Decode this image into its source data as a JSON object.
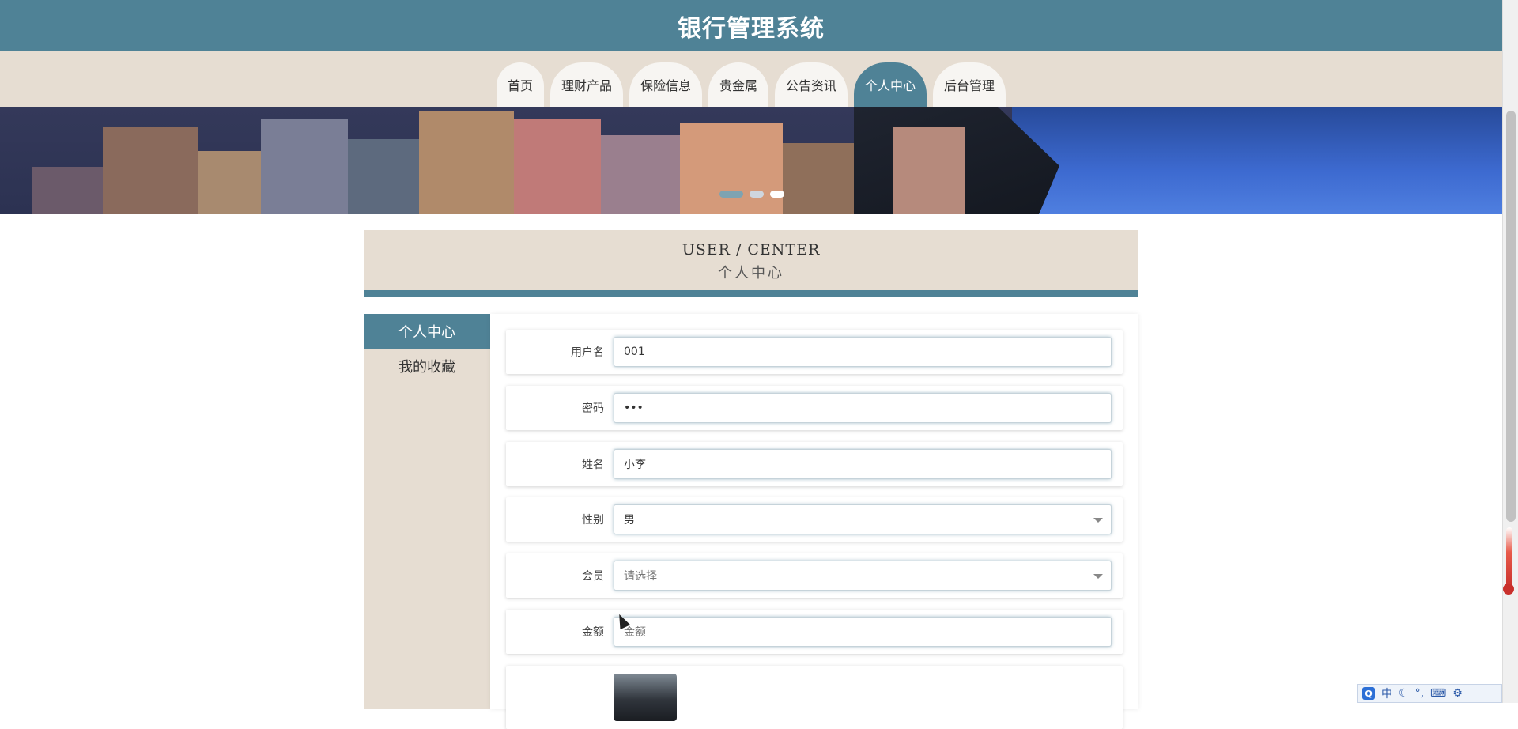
{
  "header": {
    "title": "银行管理系统"
  },
  "nav": {
    "items": [
      {
        "label": "首页"
      },
      {
        "label": "理财产品"
      },
      {
        "label": "保险信息"
      },
      {
        "label": "贵金属"
      },
      {
        "label": "公告资讯"
      },
      {
        "label": "个人中心",
        "active": true
      },
      {
        "label": "后台管理"
      }
    ]
  },
  "banner": {
    "slide_count": 3,
    "active_slide": 1
  },
  "page_title": {
    "en": "USER / CENTER",
    "cn": "个人中心"
  },
  "sidebar": {
    "items": [
      {
        "label": "个人中心",
        "active": true
      },
      {
        "label": "我的收藏"
      }
    ]
  },
  "form": {
    "username": {
      "label": "用户名",
      "value": "001"
    },
    "password": {
      "label": "密码",
      "value": "•••"
    },
    "name": {
      "label": "姓名",
      "value": "小李"
    },
    "gender": {
      "label": "性别",
      "value": "男"
    },
    "member": {
      "label": "会员",
      "placeholder": "请选择"
    },
    "amount": {
      "label": "金额",
      "placeholder": "金额"
    }
  },
  "ime": {
    "mode": "中"
  },
  "colors": {
    "primary": "#4f8296",
    "beige": "#e6ddd2"
  }
}
